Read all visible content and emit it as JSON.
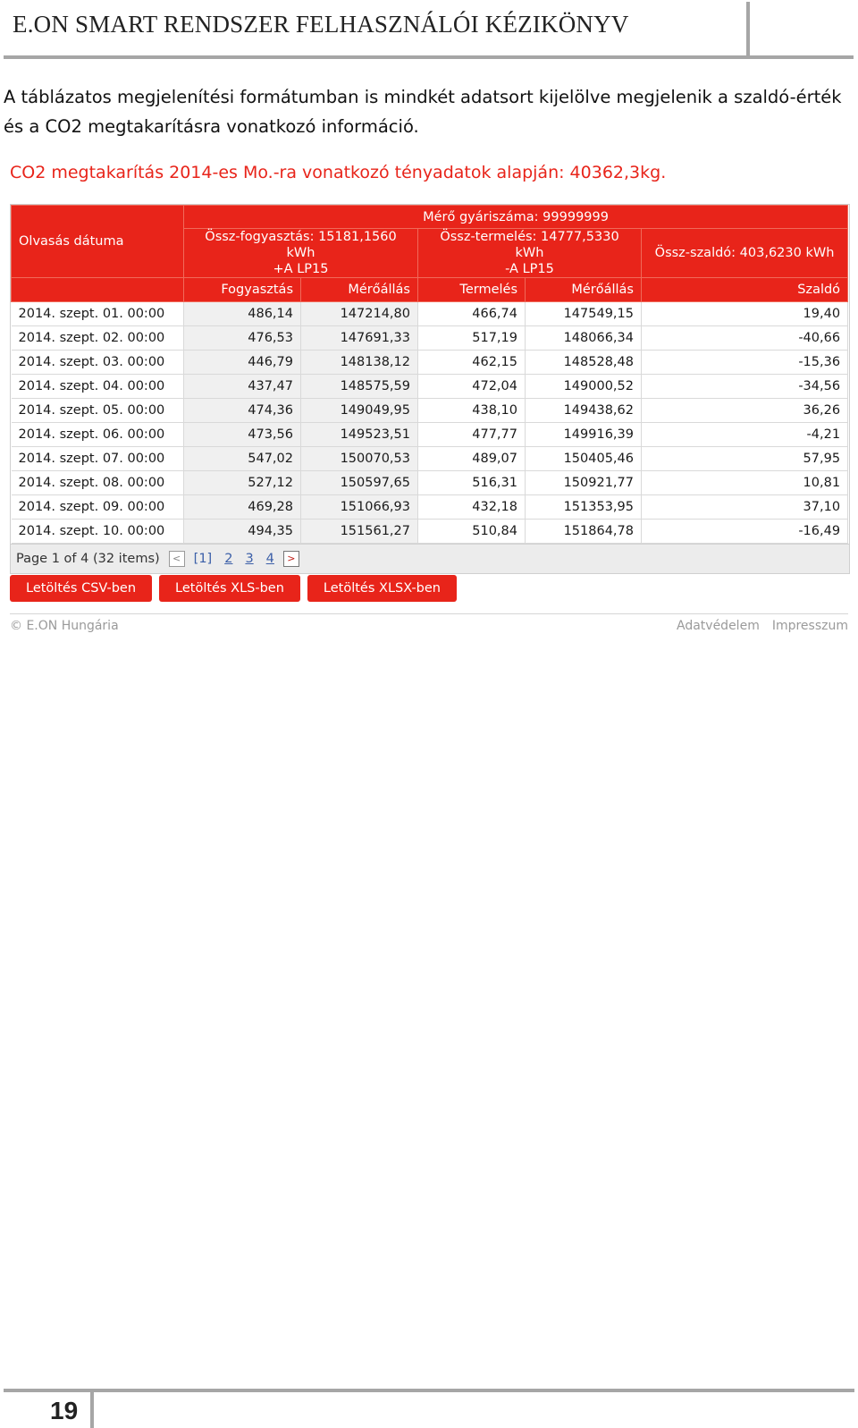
{
  "header": {
    "title": "E.ON SMART RENDSZER FELHASZNÁLÓI KÉZIKÖNYV"
  },
  "intro_text": "A táblázatos megjelenítési formátumban is mindkét adatsort kijelölve megjelenik a szaldó-érték és a CO2 megtakarításra vonatkozó információ.",
  "co2_text": "CO2 megtakarítás 2014-es Mo.-ra vonatkozó tényadatok alapján: 40362,3kg.",
  "table": {
    "date_header": "Olvasás dátuma",
    "meter_header": "Mérő gyáriszáma: 99999999",
    "consumption_header_line1": "Össz-fogyasztás: 15181,1560 kWh",
    "consumption_header_line2": "+A LP15",
    "production_header_line1": "Össz-termelés: 14777,5330 kWh",
    "production_header_line2": "-A LP15",
    "balance_header": "Össz-szaldó: 403,6230 kWh",
    "col_consumption": "Fogyasztás",
    "col_meter1": "Mérőállás",
    "col_production": "Termelés",
    "col_meter2": "Mérőállás",
    "col_balance": "Szaldó",
    "rows": [
      {
        "date": "2014. szept. 01. 00:00",
        "consumption": "486,14",
        "meter1": "147214,80",
        "production": "466,74",
        "meter2": "147549,15",
        "balance": "19,40"
      },
      {
        "date": "2014. szept. 02. 00:00",
        "consumption": "476,53",
        "meter1": "147691,33",
        "production": "517,19",
        "meter2": "148066,34",
        "balance": "-40,66"
      },
      {
        "date": "2014. szept. 03. 00:00",
        "consumption": "446,79",
        "meter1": "148138,12",
        "production": "462,15",
        "meter2": "148528,48",
        "balance": "-15,36"
      },
      {
        "date": "2014. szept. 04. 00:00",
        "consumption": "437,47",
        "meter1": "148575,59",
        "production": "472,04",
        "meter2": "149000,52",
        "balance": "-34,56"
      },
      {
        "date": "2014. szept. 05. 00:00",
        "consumption": "474,36",
        "meter1": "149049,95",
        "production": "438,10",
        "meter2": "149438,62",
        "balance": "36,26"
      },
      {
        "date": "2014. szept. 06. 00:00",
        "consumption": "473,56",
        "meter1": "149523,51",
        "production": "477,77",
        "meter2": "149916,39",
        "balance": "-4,21"
      },
      {
        "date": "2014. szept. 07. 00:00",
        "consumption": "547,02",
        "meter1": "150070,53",
        "production": "489,07",
        "meter2": "150405,46",
        "balance": "57,95"
      },
      {
        "date": "2014. szept. 08. 00:00",
        "consumption": "527,12",
        "meter1": "150597,65",
        "production": "516,31",
        "meter2": "150921,77",
        "balance": "10,81"
      },
      {
        "date": "2014. szept. 09. 00:00",
        "consumption": "469,28",
        "meter1": "151066,93",
        "production": "432,18",
        "meter2": "151353,95",
        "balance": "37,10"
      },
      {
        "date": "2014. szept. 10. 00:00",
        "consumption": "494,35",
        "meter1": "151561,27",
        "production": "510,84",
        "meter2": "151864,78",
        "balance": "-16,49"
      }
    ]
  },
  "pager": {
    "summary": "Page 1 of 4 (32 items)",
    "prev_icon": "chevron-left-icon",
    "next_icon": "chevron-right-icon",
    "pages": [
      "[1]",
      "2",
      "3",
      "4"
    ]
  },
  "buttons": {
    "csv": "Letöltés CSV-ben",
    "xls": "Letöltés XLS-ben",
    "xlsx": "Letöltés XLSX-ben"
  },
  "footer": {
    "copyright": "© E.ON Hungária",
    "privacy": "Adatvédelem",
    "imprint": "Impresszum"
  },
  "page_number": "19",
  "colors": {
    "brand_red": "#e8241a",
    "rule_gray": "#a6a6a6"
  }
}
